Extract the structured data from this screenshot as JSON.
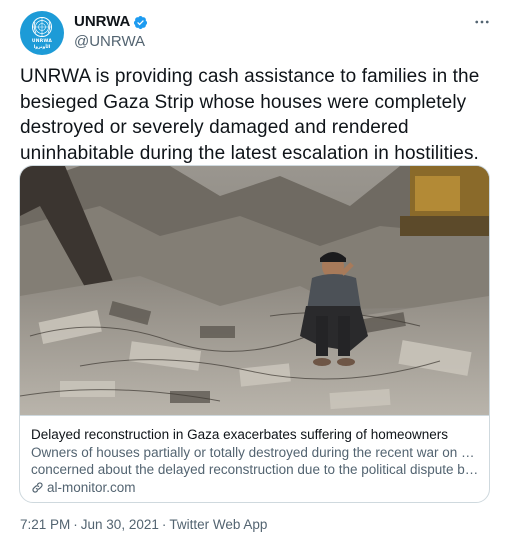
{
  "author": {
    "display_name": "UNRWA",
    "handle": "@UNRWA",
    "avatar_text": "UNRWA",
    "avatar_subtext": "الأونروا",
    "verified": true,
    "verified_icon": "verified-badge-icon",
    "avatar_color": "#1d9bd7"
  },
  "more_menu_icon": "more-horizontal-icon",
  "tweet": {
    "text": "UNRWA is providing cash assistance to families in the besieged Gaza Strip whose houses were completely destroyed or severely damaged and rendered uninhabitable during the latest escalation in hostilities."
  },
  "card": {
    "image_alt": "Man sitting on rubble of destroyed buildings",
    "title": "Delayed reconstruction in Gaza exacerbates suffering of homeowners",
    "description_line1": "Owners of houses partially or totally destroyed during the recent war on Gaza are",
    "description_line2": "concerned about the delayed reconstruction due to the political dispute betwee…",
    "domain": "al-monitor.com",
    "link_icon": "link-icon"
  },
  "meta": {
    "time": "7:21 PM",
    "date": "Jun 30, 2021",
    "separator": "·",
    "source": "Twitter Web App"
  },
  "colors": {
    "text_primary": "#0f1419",
    "text_secondary": "#536471",
    "verified_blue": "#1d9bf0",
    "border": "#cfd9de"
  }
}
